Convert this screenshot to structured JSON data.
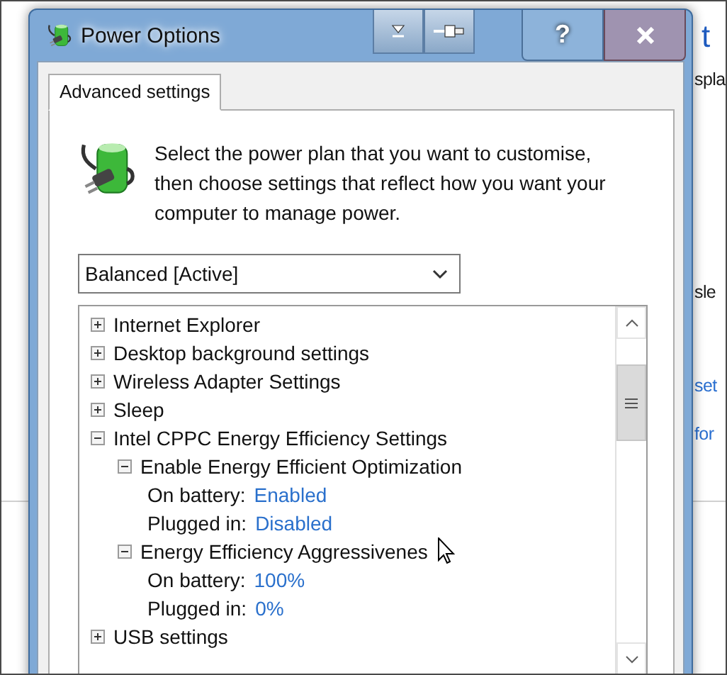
{
  "background_page": {
    "heading": "t",
    "fragments": [
      {
        "text": "spla",
        "kind": "text"
      },
      {
        "text": "sle",
        "kind": "text"
      },
      {
        "text": "set",
        "kind": "link"
      },
      {
        "text": "for",
        "kind": "link"
      }
    ]
  },
  "window": {
    "title": "Power Options",
    "help_button": "?"
  },
  "tabs": [
    {
      "label": "Advanced settings",
      "selected": true
    }
  ],
  "description": "Select the power plan that you want to customise, then choose settings that reflect how you want your computer to manage power.",
  "plan_dropdown": {
    "value": "Balanced [Active]"
  },
  "settings_tree": [
    {
      "label": "Internet Explorer",
      "expanded": false
    },
    {
      "label": "Desktop background settings",
      "expanded": false
    },
    {
      "label": "Wireless Adapter Settings",
      "expanded": false
    },
    {
      "label": "Sleep",
      "expanded": false
    },
    {
      "label": "Intel CPPC Energy Efficiency Settings",
      "expanded": true,
      "children": [
        {
          "label": "Enable Energy Efficient Optimization",
          "expanded": true,
          "children": [
            {
              "label": "On battery:",
              "value": "Enabled"
            },
            {
              "label": "Plugged in:",
              "value": "Disabled"
            }
          ]
        },
        {
          "label": "Energy Efficiency Aggressivenes",
          "expanded": true,
          "children": [
            {
              "label": "On battery:",
              "value": "100%"
            },
            {
              "label": "Plugged in:",
              "value": "0%"
            }
          ]
        }
      ]
    },
    {
      "label": "USB settings",
      "expanded": false
    }
  ]
}
